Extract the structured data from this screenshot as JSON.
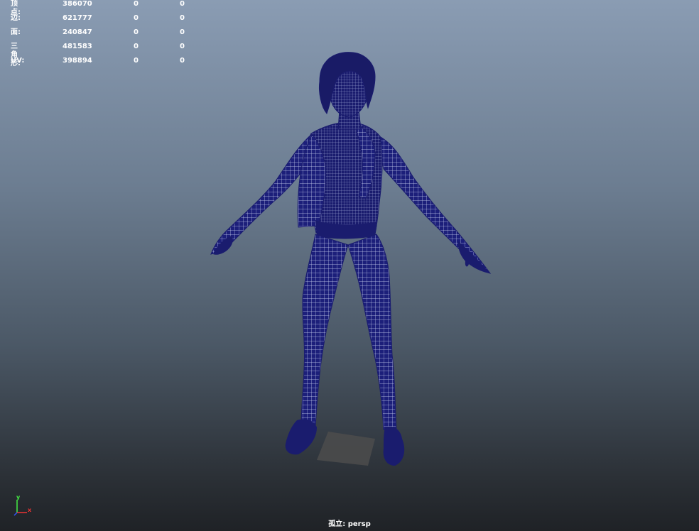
{
  "hud": {
    "rows": [
      {
        "label": "顶点:",
        "value": "386070",
        "selected": "0",
        "selected2": "0"
      },
      {
        "label": "边:",
        "value": "621777",
        "selected": "0",
        "selected2": "0"
      },
      {
        "label": "面:",
        "value": "240847",
        "selected": "0",
        "selected2": "0"
      },
      {
        "label": "三角形:",
        "value": "481583",
        "selected": "0",
        "selected2": "0"
      },
      {
        "label": "UV:",
        "value": "398894",
        "selected": "0",
        "selected2": "0"
      }
    ]
  },
  "axis": {
    "y_label": "y",
    "x_label": "x",
    "y_color": "#44ee44",
    "x_color": "#ee3333",
    "z_color": "#3355ff"
  },
  "camera": {
    "label": "孤立: persp"
  },
  "colors": {
    "wireframe": "#1c1f7a",
    "wire_line": "#d6dcf2",
    "ground_patch": "#4c4c4c"
  },
  "icons": {
    "axis": "axis-gizmo-icon"
  }
}
